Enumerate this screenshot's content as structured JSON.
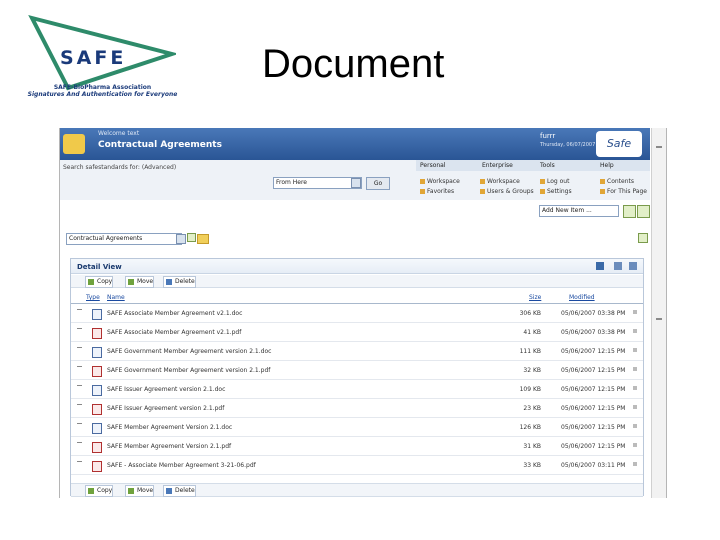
{
  "slide": {
    "title": "Document",
    "logo_text": "SAFE",
    "logo_org": "SAFE-BioPharma Association",
    "logo_tagline": "Signatures And Authentication for Everyone"
  },
  "sharepoint": {
    "welcome": "Welcome text",
    "area_title": "Contractual Agreements",
    "user": "furrr",
    "date": "Thursday, 06/07/2007",
    "brand": "Safe",
    "search_label": "Search safestandards for: (Advanced)",
    "search_scope": "From Here",
    "go_label": "Go",
    "menus": [
      "Personal",
      "Enterprise",
      "Tools",
      "Help"
    ],
    "menu_items": {
      "personal": [
        "Workspace",
        "Favorites"
      ],
      "enterprise": [
        "Workspace",
        "Users & Groups"
      ],
      "tools": [
        "Log out",
        "Settings"
      ],
      "help": [
        "Contents",
        "For This Page"
      ]
    },
    "add_new": "Add New Item ...",
    "view_select": "Contractual Agreements",
    "detail_title": "Detail View",
    "toolbar": [
      "Copy",
      "Move",
      "Delete"
    ],
    "columns": {
      "type": "Type",
      "name": "Name",
      "size": "Size",
      "modified": "Modified"
    },
    "files": [
      {
        "name": "SAFE Associate Member Agreement v2.1.doc",
        "type": "doc",
        "size": "306 KB",
        "modified": "05/06/2007 03:38 PM"
      },
      {
        "name": "SAFE Associate Member Agreement v2.1.pdf",
        "type": "pdf",
        "size": "41 KB",
        "modified": "05/06/2007 03:38 PM"
      },
      {
        "name": "SAFE Government Member Agreement version 2.1.doc",
        "type": "doc",
        "size": "111 KB",
        "modified": "05/06/2007 12:15 PM"
      },
      {
        "name": "SAFE Government Member Agreement version 2.1.pdf",
        "type": "pdf",
        "size": "32 KB",
        "modified": "05/06/2007 12:15 PM"
      },
      {
        "name": "SAFE Issuer Agreement version 2.1.doc",
        "type": "doc",
        "size": "109 KB",
        "modified": "05/06/2007 12:15 PM"
      },
      {
        "name": "SAFE Issuer Agreement version 2.1.pdf",
        "type": "pdf",
        "size": "23 KB",
        "modified": "05/06/2007 12:15 PM"
      },
      {
        "name": "SAFE Member Agreement Version 2.1.doc",
        "type": "doc",
        "size": "126 KB",
        "modified": "05/06/2007 12:15 PM"
      },
      {
        "name": "SAFE Member Agreement Version 2.1.pdf",
        "type": "pdf",
        "size": "31 KB",
        "modified": "05/06/2007 12:15 PM"
      },
      {
        "name": "SAFE - Associate Member Agreement 3-21-06.pdf",
        "type": "pdf",
        "size": "33 KB",
        "modified": "05/06/2007 03:11 PM"
      }
    ]
  },
  "colors": {
    "accent": "#2a5595",
    "logo_blue": "#1a3a7a",
    "logo_green": "#2e8b6a"
  }
}
